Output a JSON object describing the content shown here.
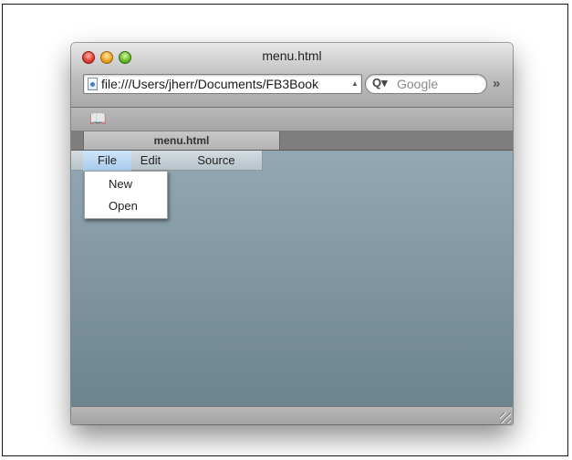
{
  "window": {
    "title": "menu.html",
    "url": "file:///Users/jherr/Documents/FB3Book",
    "search_placeholder": "Google",
    "tab_label": "menu.html"
  },
  "menubar": {
    "items": [
      {
        "label": "File"
      },
      {
        "label": "Edit"
      },
      {
        "label": "Source"
      }
    ]
  },
  "dropdown": {
    "items": [
      {
        "label": "New"
      },
      {
        "label": "Open"
      }
    ]
  },
  "icons": {
    "close": "close-button",
    "minimize": "minimize-button",
    "zoom": "zoom-button",
    "page": "page-icon",
    "search": "search-icon",
    "overflow": "overflow-chevron-icon",
    "bookmarks": "bookmarks-book-icon",
    "resize": "resize-grip-icon"
  },
  "colors": {
    "content_top": "#93a8b2",
    "content_bottom": "#6c848f",
    "menu_selected": "#a8cbee"
  }
}
